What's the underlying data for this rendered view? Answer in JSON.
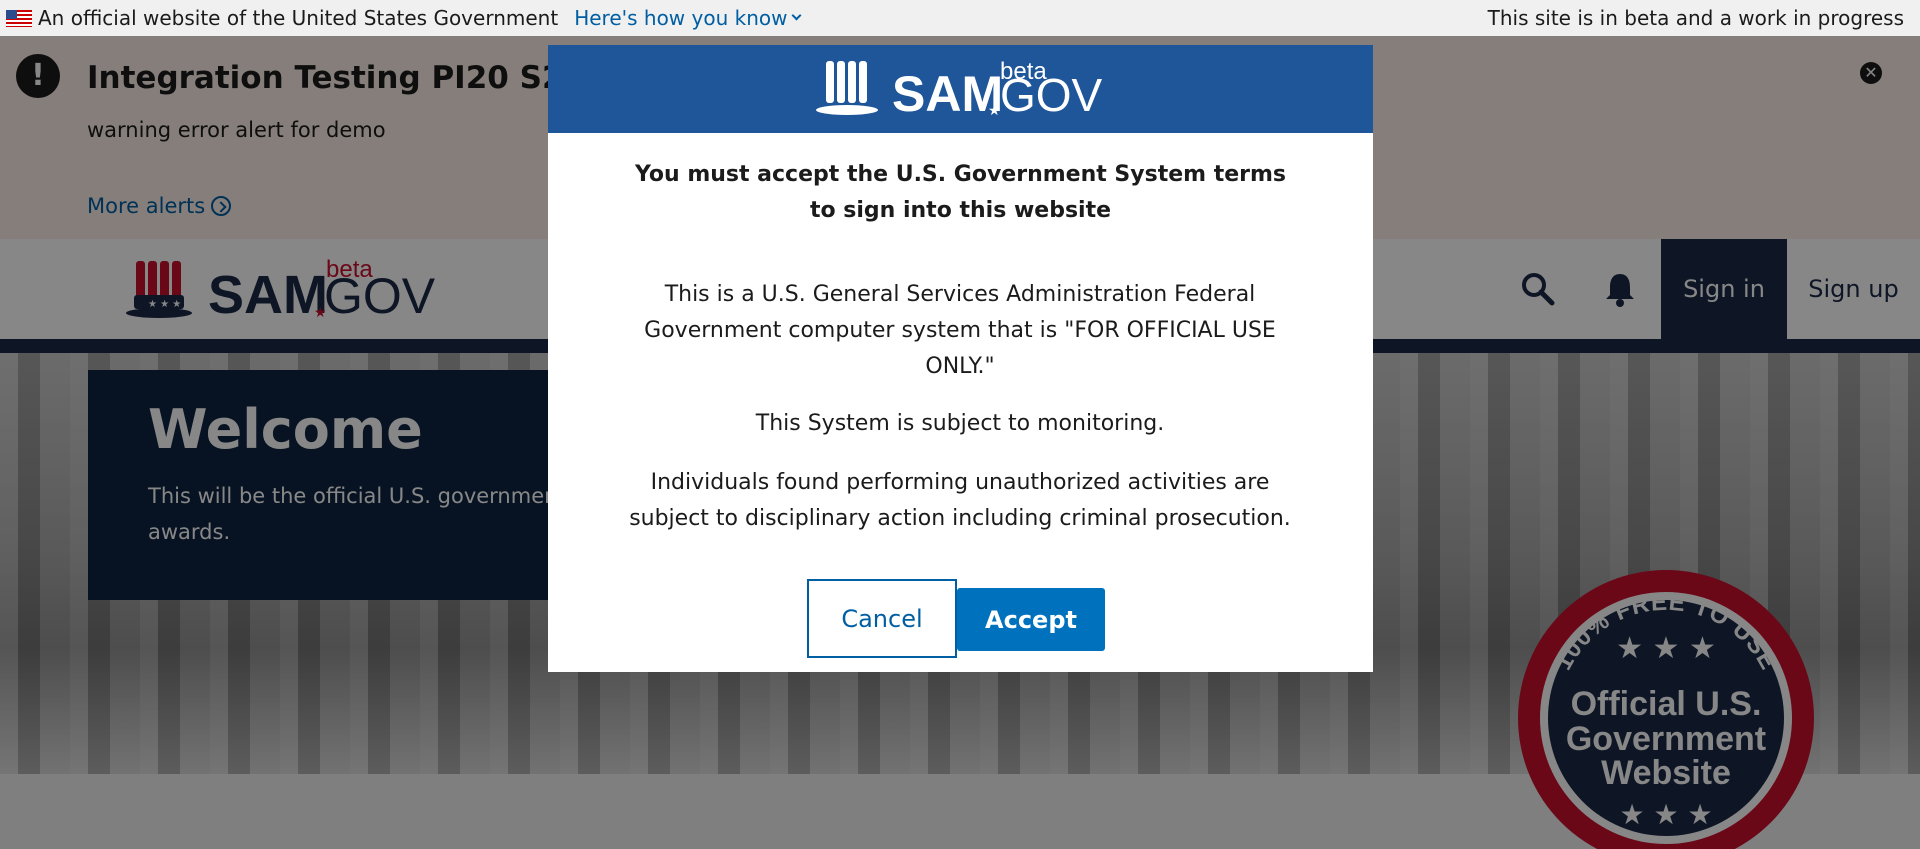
{
  "gov_banner": {
    "official_text": "An official website of the United States Government",
    "how_know_link": "Here's how you know",
    "beta_note": "This site is in beta and a work in progress"
  },
  "alert": {
    "title": "Integration Testing PI20 S2",
    "body": "warning error alert for demo",
    "more_link": "More alerts"
  },
  "logo": {
    "sam": "SAM",
    "gov": "GOV",
    "beta": "beta"
  },
  "header": {
    "signin_label": "Sign in",
    "signup_label": "Sign up"
  },
  "hero": {
    "title": "Welcome",
    "text": "This will be the official U.S. government awards."
  },
  "seal": {
    "ring_text": "100% FREE TO USE",
    "line1": "Official U.S.",
    "line2": "Government",
    "line3": "Website"
  },
  "modal": {
    "heading_line1": "You must accept the U.S. Government System terms",
    "heading_line2": "to sign into this website",
    "para1": "This is a U.S. General Services Administration Federal Government computer system that is \"FOR OFFICIAL USE ONLY.\"",
    "para2": "This System is subject to monitoring.",
    "para3": "Individuals found performing unauthorized activities are subject to disciplinary action including criminal prosecution.",
    "cancel_label": "Cancel",
    "accept_label": "Accept"
  },
  "colors": {
    "primary_blue": "#0071bc",
    "modal_header": "#1f5599",
    "nav_dark": "#1b2a47",
    "alert_bg": "#fbeee6",
    "logo_red": "#c8102e"
  },
  "icons": {
    "alert": "exclamation-circle-icon",
    "close": "close-icon",
    "search": "search-icon",
    "notifications": "bell-icon",
    "more": "arrow-circle-right-icon"
  }
}
